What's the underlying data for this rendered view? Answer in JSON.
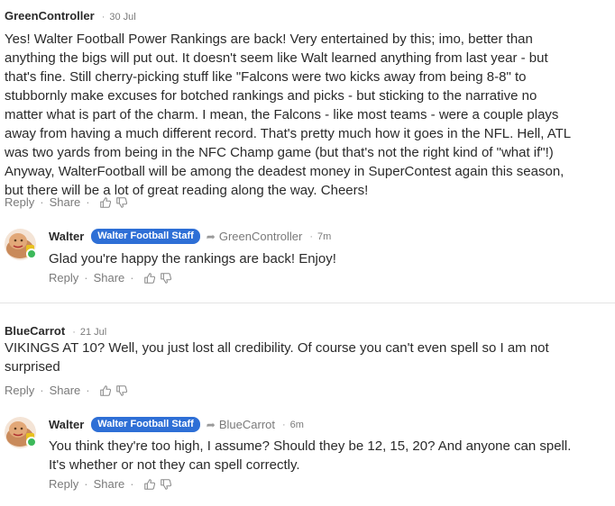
{
  "colors": {
    "badge": "#2e6fd6",
    "online": "#3cb95a",
    "meta": "#7a7a7a",
    "text": "#2a2a2a"
  },
  "icons": {
    "like": "thumbs-up-icon",
    "dislike": "thumbs-down-icon",
    "reply_arrow": "share-arrow-icon"
  },
  "actions": {
    "reply": "Reply",
    "share": "Share",
    "sep": "·"
  },
  "comments": [
    {
      "author": "GreenController",
      "time": "30 Jul",
      "lines": [
        "Yes! Walter Football Power Rankings are back!  Very entertained by this; imo, better than",
        "anything the bigs will put out.  It doesn't seem like Walt learned anything from last year - but",
        "that's fine.  Still cherry-picking stuff like \"Falcons were two kicks away from being 8-8\" to",
        "stubbornly make excuses for botched rankings and picks - but sticking to the narrative no",
        "matter what is part of the charm.  I mean, the Falcons - like most teams - were a couple plays",
        "away from having a much different record.  That's pretty much how it goes in the NFL.  Hell, ATL",
        "was two yards from being in the NFC Champ game (but that's not the right kind of \"what if\"!)",
        "Anyway, WalterFootball will be among the deadest money in SuperContest again this season,",
        "but there will be a lot of great reading along the way.  Cheers!"
      ],
      "reply": {
        "author": "Walter",
        "badge": "Walter Football Staff",
        "reply_to": "GreenController",
        "time": "7m",
        "lines": [
          "Glad you're happy the rankings are back! Enjoy!"
        ]
      }
    },
    {
      "author": "BlueCarrot",
      "time": "21 Jul",
      "lines": [
        "VIKINGS AT 10? Well, you just lost all credibility. Of course you can't even spell so I am not",
        "surprised"
      ],
      "reply": {
        "author": "Walter",
        "badge": "Walter Football Staff",
        "reply_to": "BlueCarrot",
        "time": "6m",
        "lines": [
          "You think they're too high, I assume? Should they be 12, 15, 20? And anyone can spell.",
          "It's whether or not they can spell correctly."
        ]
      }
    }
  ]
}
